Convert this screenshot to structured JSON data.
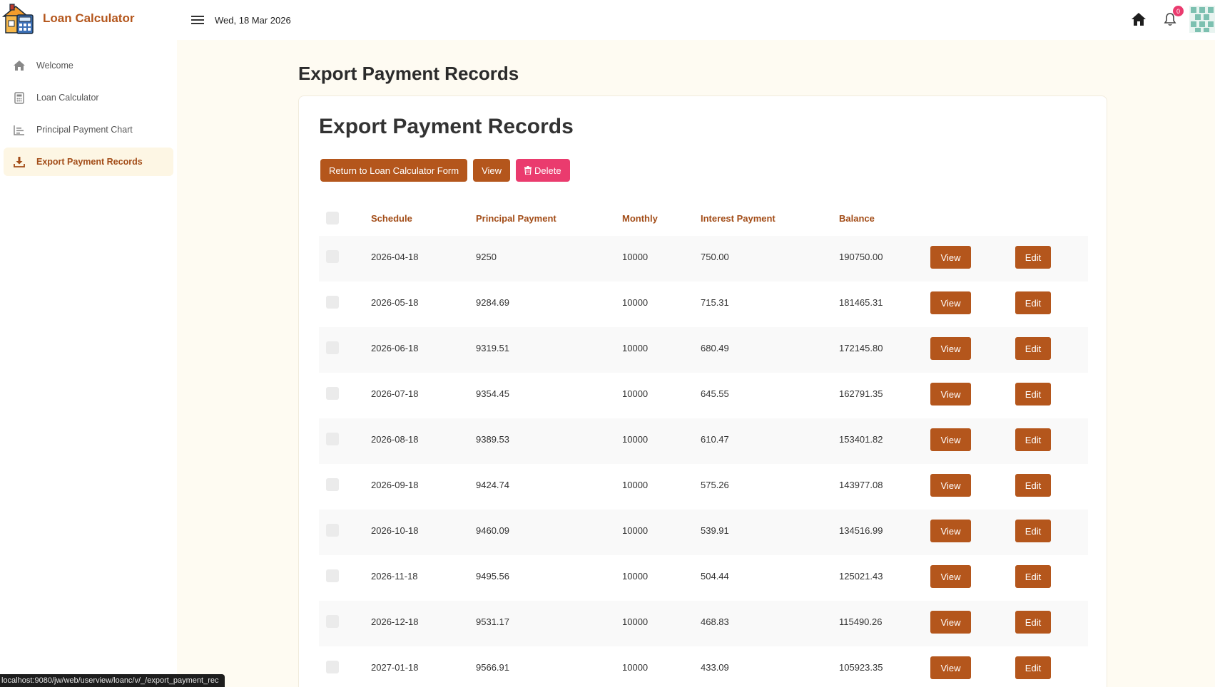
{
  "app": {
    "title": "Loan Calculator"
  },
  "topbar": {
    "date": "Wed, 18 Mar 2026",
    "notification_count": "0"
  },
  "sidebar": {
    "items": [
      {
        "label": "Welcome",
        "icon": "home-icon"
      },
      {
        "label": "Loan Calculator",
        "icon": "calculator-icon"
      },
      {
        "label": "Principal Payment Chart",
        "icon": "bar-chart-icon"
      },
      {
        "label": "Export Payment Records",
        "icon": "download-icon",
        "active": true
      }
    ]
  },
  "page": {
    "heading": "Export Payment Records"
  },
  "card": {
    "title": "Export Payment Records",
    "actions": {
      "return_label": "Return to Loan Calculator Form",
      "view_label": "View",
      "delete_label": "Delete"
    }
  },
  "table": {
    "headers": {
      "schedule": "Schedule",
      "principal": "Principal Payment",
      "monthly": "Monthly",
      "interest": "Interest Payment",
      "balance": "Balance"
    },
    "view_label": "View",
    "edit_label": "Edit",
    "rows": [
      {
        "schedule": "2026-04-18",
        "principal": "9250",
        "monthly": "10000",
        "interest": "750.00",
        "balance": "190750.00"
      },
      {
        "schedule": "2026-05-18",
        "principal": "9284.69",
        "monthly": "10000",
        "interest": "715.31",
        "balance": "181465.31"
      },
      {
        "schedule": "2026-06-18",
        "principal": "9319.51",
        "monthly": "10000",
        "interest": "680.49",
        "balance": "172145.80"
      },
      {
        "schedule": "2026-07-18",
        "principal": "9354.45",
        "monthly": "10000",
        "interest": "645.55",
        "balance": "162791.35"
      },
      {
        "schedule": "2026-08-18",
        "principal": "9389.53",
        "monthly": "10000",
        "interest": "610.47",
        "balance": "153401.82"
      },
      {
        "schedule": "2026-09-18",
        "principal": "9424.74",
        "monthly": "10000",
        "interest": "575.26",
        "balance": "143977.08"
      },
      {
        "schedule": "2026-10-18",
        "principal": "9460.09",
        "monthly": "10000",
        "interest": "539.91",
        "balance": "134516.99"
      },
      {
        "schedule": "2026-11-18",
        "principal": "9495.56",
        "monthly": "10000",
        "interest": "504.44",
        "balance": "125021.43"
      },
      {
        "schedule": "2026-12-18",
        "principal": "9531.17",
        "monthly": "10000",
        "interest": "468.83",
        "balance": "115490.26"
      },
      {
        "schedule": "2027-01-18",
        "principal": "9566.91",
        "monthly": "10000",
        "interest": "433.09",
        "balance": "105923.35"
      }
    ]
  },
  "status_bar": {
    "url": "localhost:9080/jw/web/userview/loanc/v/_/export_payment_rec"
  },
  "colors": {
    "brand": "#b4561c",
    "delete": "#ea3b6e",
    "active_nav_bg": "#fdf6e4",
    "page_bg": "#fefbf2"
  }
}
